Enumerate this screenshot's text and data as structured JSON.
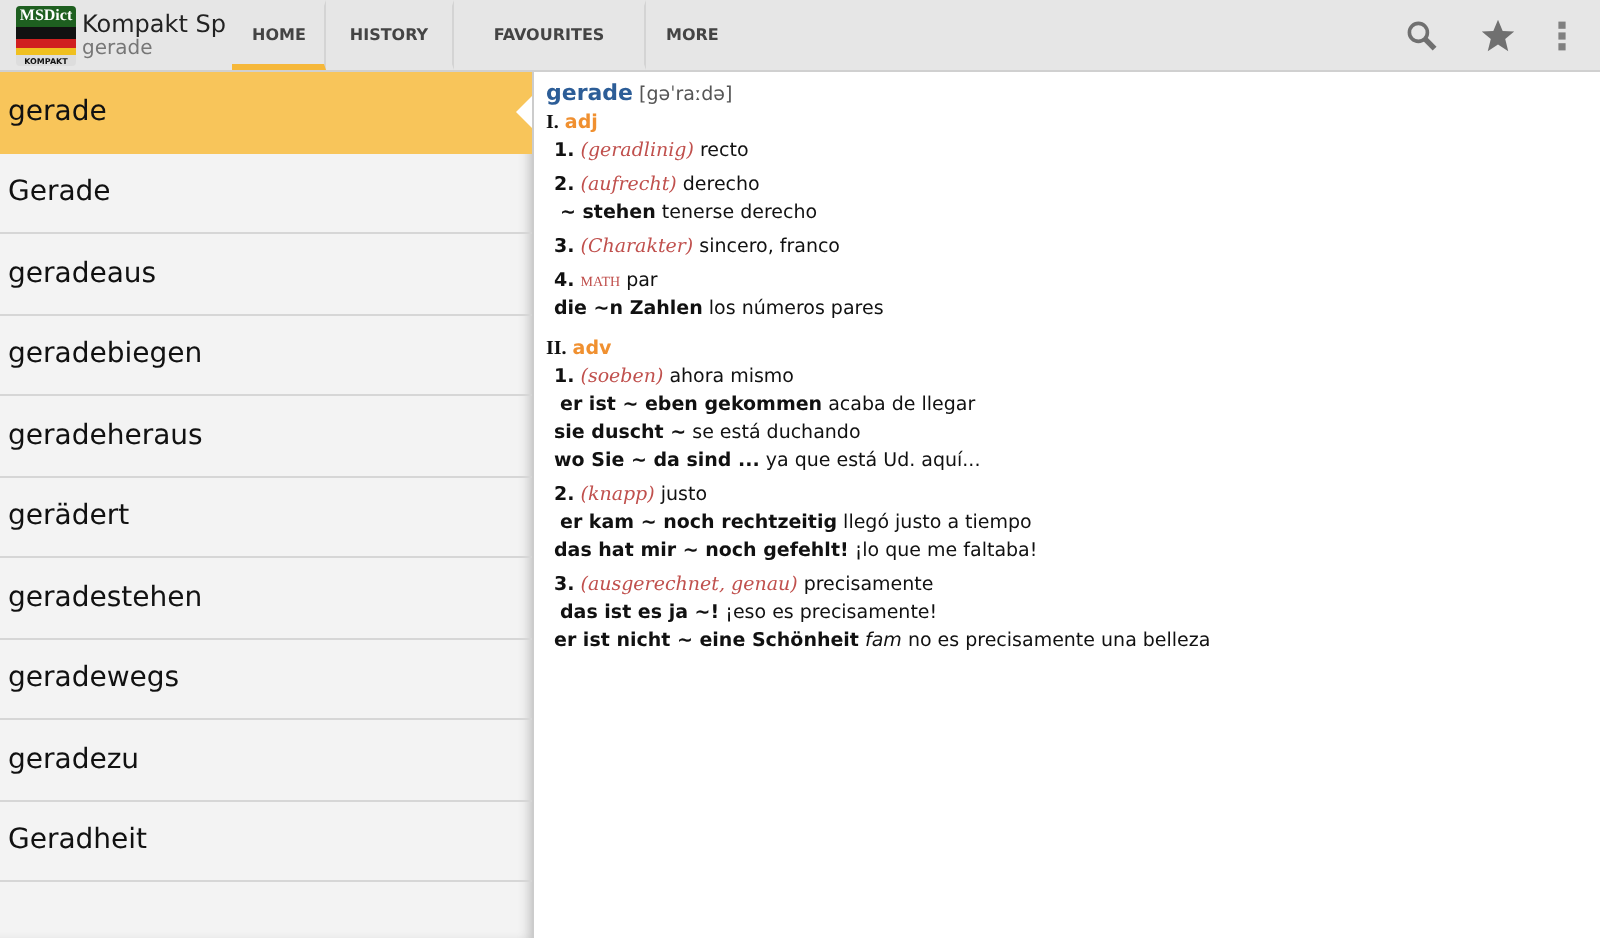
{
  "app": {
    "title": "Kompakt Sp",
    "subtitle": "gerade",
    "logo_text": "MSDict",
    "logo_badge": "KOMPAKT"
  },
  "tabs": [
    {
      "label": "HOME",
      "selected": true
    },
    {
      "label": "HISTORY",
      "selected": false
    },
    {
      "label": "FAVOURITES",
      "selected": false
    },
    {
      "label": "MORE",
      "selected": false
    }
  ],
  "word_list": [
    {
      "word": "gerade",
      "selected": true
    },
    {
      "word": "Gerade",
      "selected": false
    },
    {
      "word": "geradeaus",
      "selected": false
    },
    {
      "word": "geradebiegen",
      "selected": false
    },
    {
      "word": "geradeheraus",
      "selected": false
    },
    {
      "word": "gerädert",
      "selected": false
    },
    {
      "word": "geradestehen",
      "selected": false
    },
    {
      "word": "geradewegs",
      "selected": false
    },
    {
      "word": "geradezu",
      "selected": false
    },
    {
      "word": "Geradheit",
      "selected": false
    }
  ],
  "entry": {
    "headword": "gerade",
    "pronunciation": "[gəˈraːdə]",
    "sections": [
      {
        "roman": "I.",
        "pos": "adj",
        "senses": [
          {
            "num": "1.",
            "kind": "gloss",
            "note": "(geradlinig)",
            "translation": "recto"
          },
          {
            "num": "2.",
            "kind": "gloss",
            "note": "(aufrecht)",
            "translation": "derecho",
            "examples": [
              {
                "text": "**~ stehen** tenerse derecho",
                "indented": true
              }
            ]
          },
          {
            "num": "3.",
            "kind": "gloss",
            "note": "(Charakter)",
            "translation": "sincero, franco"
          },
          {
            "num": "4.",
            "kind": "label",
            "note": "MATH",
            "translation": "par",
            "examples": [
              {
                "text": "**die ~n Zahlen** los números pares",
                "indented": false
              }
            ]
          }
        ]
      },
      {
        "roman": "II.",
        "pos": "adv",
        "senses": [
          {
            "num": "1.",
            "kind": "gloss",
            "note": "(soeben)",
            "translation": "ahora mismo",
            "examples": [
              {
                "text": "**er ist ~ eben gekommen** acaba de llegar",
                "indented": true
              },
              {
                "text": "**sie duscht ~** se está duchando",
                "indented": false
              },
              {
                "text": "**wo Sie ~ da sind ...** ya que está Ud. aquí...",
                "indented": false
              }
            ]
          },
          {
            "num": "2.",
            "kind": "gloss",
            "note": "(knapp)",
            "translation": "justo",
            "examples": [
              {
                "text": "**er kam ~ noch rechtzeitig** llegó justo a tiempo",
                "indented": true
              },
              {
                "text": "**das hat mir ~ noch gefehlt!** ¡lo que me faltaba!",
                "indented": false
              }
            ]
          },
          {
            "num": "3.",
            "kind": "gloss",
            "note": "(ausgerechnet, genau)",
            "translation": "precisamente",
            "examples": [
              {
                "text": "**das ist es ja ~!** ¡eso es precisamente!",
                "indented": true
              },
              {
                "text": "**er ist nicht ~ eine Schönheit** *fam* no es precisamente una belleza",
                "indented": false
              }
            ]
          }
        ]
      }
    ]
  }
}
